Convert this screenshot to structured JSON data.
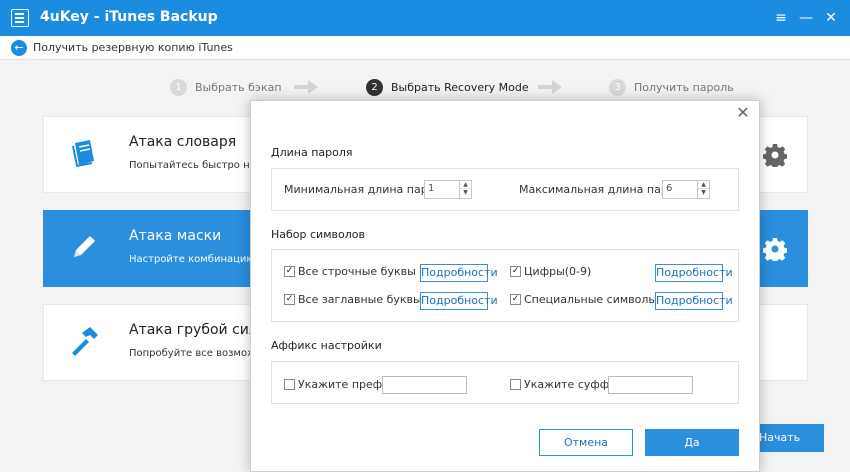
{
  "window": {
    "title": "4uKey - iTunes Backup",
    "controls": [
      "≡",
      "—",
      "✕"
    ]
  },
  "subbar": {
    "text": "Получить резервную копию iTunes"
  },
  "steps": [
    {
      "num": "1",
      "label": "Выбрать бэкап",
      "active": false
    },
    {
      "num": "2",
      "label": "Выбрать Recovery Mode",
      "active": true
    },
    {
      "num": "3",
      "label": "Получить пароль",
      "active": false
    }
  ],
  "cards": [
    {
      "title": "Атака словаря",
      "desc": "Попытайтесь быстро найти",
      "icon": "book-icon",
      "active": false
    },
    {
      "title": "Атака маски",
      "desc": "Настройте комбинацию сим",
      "icon": "pencil-icon",
      "active": true
    },
    {
      "title": "Атака грубой силой",
      "desc": "Попробуйте все возможные",
      "icon": "hammer-icon",
      "active": false
    }
  ],
  "start_button": "Начать",
  "modal": {
    "length_section": {
      "title": "Длина пароля",
      "min_label": "Минимальная длина пароля",
      "min_value": "1",
      "max_label": "Максимальная длина пароля",
      "max_value": "6"
    },
    "charset_section": {
      "title": "Набор символов",
      "options": [
        {
          "label": "Все строчные буквы (a-z)",
          "checked": true,
          "details": "Подробности"
        },
        {
          "label": "Цифры(0-9)",
          "checked": true,
          "details": "Подробности"
        },
        {
          "label": "Все заглавные буквы (A-Z)",
          "checked": true,
          "details": "Подробности"
        },
        {
          "label": "Специальные символы($@..)",
          "checked": true,
          "details": "Подробности"
        }
      ]
    },
    "affix_section": {
      "title": "Аффикс настройки",
      "prefix_label": "Укажите префикс:",
      "prefix_value": "",
      "suffix_label": "Укажите суффикс:",
      "suffix_value": ""
    },
    "cancel_label": "Отмена",
    "ok_label": "Да",
    "close_glyph": "✕"
  },
  "colors": {
    "accent": "#2a8fde",
    "titlebar": "#1b8de0"
  }
}
